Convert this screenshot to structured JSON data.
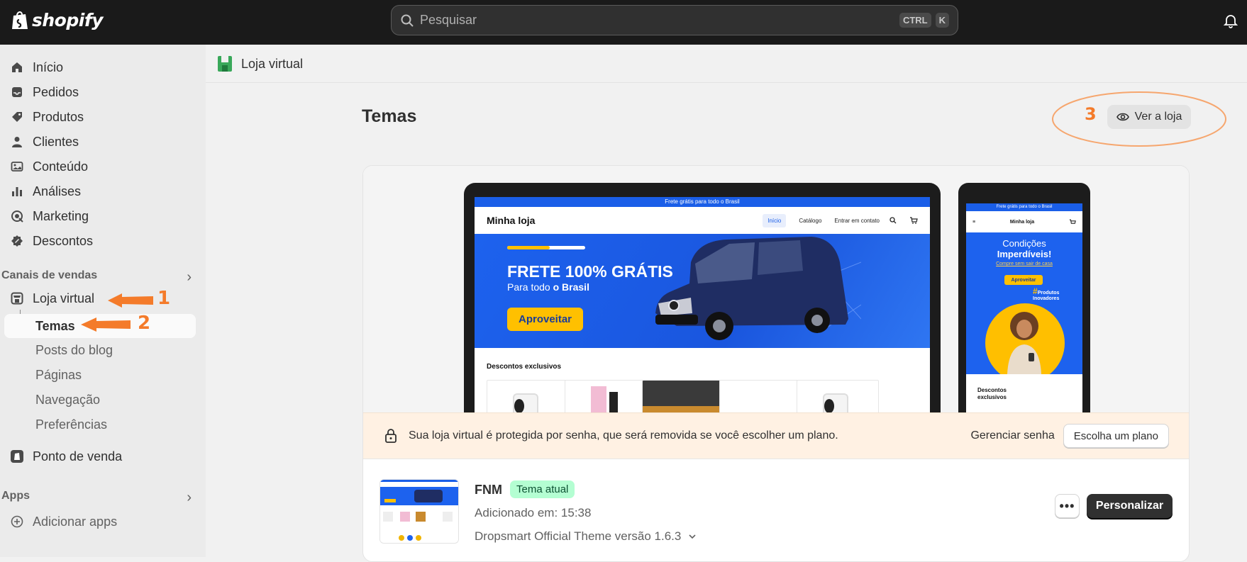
{
  "topbar": {
    "brand": "shopify",
    "search_placeholder": "Pesquisar",
    "kbd_1": "CTRL",
    "kbd_2": "K"
  },
  "sidebar": {
    "items": [
      {
        "label": "Início",
        "icon": "home-icon"
      },
      {
        "label": "Pedidos",
        "icon": "inbox-icon"
      },
      {
        "label": "Produtos",
        "icon": "tag-icon"
      },
      {
        "label": "Clientes",
        "icon": "person-icon"
      },
      {
        "label": "Conteúdo",
        "icon": "image-icon"
      },
      {
        "label": "Análises",
        "icon": "bar-chart-icon"
      },
      {
        "label": "Marketing",
        "icon": "target-icon"
      },
      {
        "label": "Descontos",
        "icon": "discount-icon"
      }
    ],
    "sales_channels_heading": "Canais de vendas",
    "online_store": "Loja virtual",
    "themes": "Temas",
    "sub_items": [
      "Posts do blog",
      "Páginas",
      "Navegação",
      "Preferências"
    ],
    "pos": "Ponto de venda",
    "apps_heading": "Apps",
    "add_apps": "Adicionar apps"
  },
  "annotations": {
    "one": "1",
    "two": "2",
    "three": "3",
    "color": "#f47b2a"
  },
  "breadcrumb": {
    "label": "Loja virtual"
  },
  "page": {
    "title": "Temas",
    "view_store_button": "Ver a loja"
  },
  "preview": {
    "laptop": {
      "announcement": "Frete grátis para todo o Brasil",
      "brand": "Minha loja",
      "nav": [
        "Início",
        "Catálogo",
        "Entrar em contato"
      ],
      "hero_title": "FRETE 100% GRÁTIS",
      "hero_subtitle_pre": "Para todo ",
      "hero_subtitle_bold": "o Brasil",
      "hero_button": "Aproveitar",
      "section_title": "Descontos exclusivos"
    },
    "phone": {
      "announcement": "Frete grátis para todo o Brasil",
      "brand": "Minha loja",
      "hero_line1": "Condições",
      "hero_line2": "Imperdíveis!",
      "hero_link": "Compre sem sair de casa",
      "hero_button": "Aproveitar",
      "tag": "Produtos Inovadores",
      "section_title": "Descontos exclusivos"
    }
  },
  "notice": {
    "text": "Sua loja virtual é protegida por senha, que será removida se você escolher um plano.",
    "manage_password": "Gerenciar senha",
    "choose_plan": "Escolha um plano"
  },
  "theme": {
    "name": "FNM",
    "badge": "Tema atual",
    "added": "Adicionado em: 15:38",
    "version": "Dropsmart Official Theme versão 1.6.3",
    "more": "•••",
    "customize": "Personalizar"
  }
}
